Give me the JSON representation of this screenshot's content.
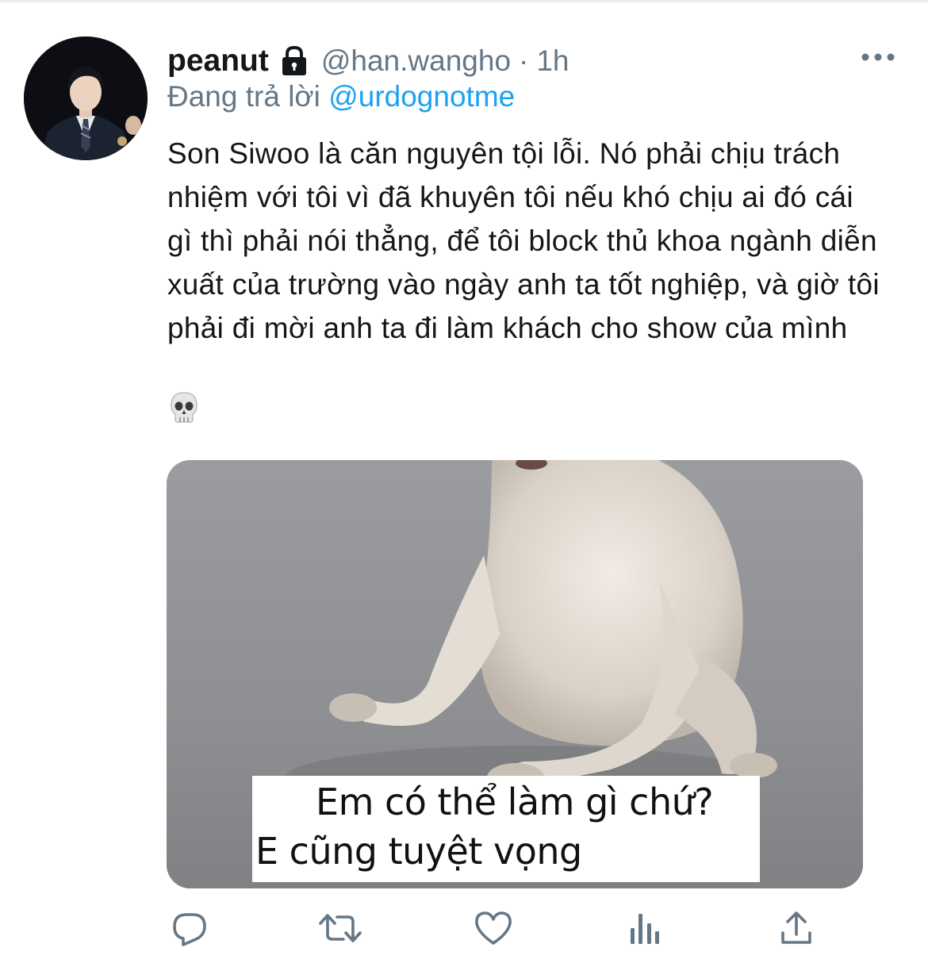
{
  "tweet": {
    "display_name": "peanut",
    "handle": "@han.wangho",
    "separator": "·",
    "time": "1h",
    "reply_prefix": "Đang trả lời",
    "reply_to": "@urdognotme",
    "text": "Son Siwoo là căn nguyên tội lỗi. Nó phải chịu trách nhiệm với tôi vì đã khuyên tôi nếu khó chịu ai đó cái gì thì phải nói thẳng, để tôi block thủ khoa ngành diễn xuất của trường vào ngày anh ta tốt nghiệp, và giờ tôi phải đi mời anh ta đi làm khách cho show của mình",
    "emoji": "💀"
  },
  "media": {
    "caption_line1": "Em có thể làm gì chứ?",
    "caption_line2": "E cũng tuyệt vọng"
  },
  "icons": {
    "protected": "lock-icon",
    "more": "more-icon",
    "reply": "reply-icon",
    "retweet": "retweet-icon",
    "like": "like-icon",
    "analytics": "analytics-icon",
    "share": "share-icon"
  },
  "colors": {
    "text_primary": "#14171a",
    "text_secondary": "#657786",
    "mention": "#1da1f2",
    "icon": "#657786"
  }
}
